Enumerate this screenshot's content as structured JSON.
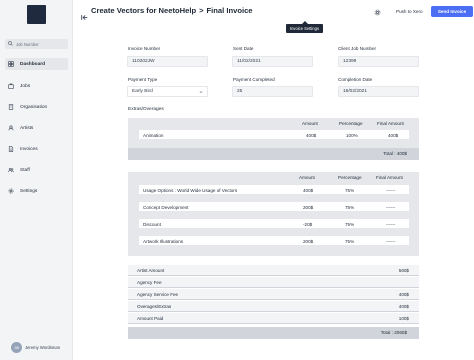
{
  "sidebar": {
    "search_placeholder": "Job Number",
    "items": [
      {
        "label": "Dashboard",
        "icon": "dashboard-icon",
        "active": true
      },
      {
        "label": "Jobs",
        "icon": "briefcase-icon",
        "active": false
      },
      {
        "label": "Organisation",
        "icon": "building-icon",
        "active": false
      },
      {
        "label": "Artists",
        "icon": "user-icon",
        "active": false
      },
      {
        "label": "Invoices",
        "icon": "document-icon",
        "active": false
      },
      {
        "label": "Staff",
        "icon": "users-icon",
        "active": false
      },
      {
        "label": "Settings",
        "icon": "gear-icon",
        "active": false
      }
    ],
    "user": {
      "initials": "JW",
      "name": "Jeremy Wordsman"
    }
  },
  "header": {
    "crumb_1": "Create Vectors for NeetoHelp",
    "crumb_sep": ">",
    "crumb_2": "Final Invoice",
    "tooltip": "Invoice Settings",
    "push_label": "Push to Xero",
    "send_label": "Send Invoice",
    "accent_color": "#4c6ef5"
  },
  "form": {
    "invoice_number_label": "Invoice Number",
    "invoice_number": "110202JW",
    "sent_date_label": "Sent Date",
    "sent_date": "11/02/2021",
    "client_job_label": "Client Job Number",
    "client_job": "12399",
    "payment_type_label": "Payment Type",
    "payment_type": "Early Bird",
    "payment_completed_label": "Payment Completed",
    "payment_completed": "25",
    "completion_date_label": "Completion Date",
    "completion_date": "16/02/2021"
  },
  "extras": {
    "title": "Extras/Overages",
    "headers": {
      "amount": "Amount",
      "percentage": "Percentage",
      "final": "Final Amount"
    },
    "rows": [
      {
        "name": "Animation",
        "amount": "400$",
        "percentage": "100%",
        "final": "400$"
      }
    ],
    "total": "Total : 400$"
  },
  "usage": {
    "headers": {
      "amount": "Amount",
      "percentage": "Percentage",
      "final": "Final Amount"
    },
    "rows": [
      {
        "name": "Usage Options : World Wide Usage of Vectors",
        "amount": "400$",
        "percentage": "75%",
        "final": "------"
      },
      {
        "name": "Concept Development",
        "amount": "200$",
        "percentage": "75%",
        "final": "------"
      },
      {
        "name": "Discount",
        "amount": "-20$",
        "percentage": "75%",
        "final": "------"
      },
      {
        "name": "Artwork Illustrations",
        "amount": "200$",
        "percentage": "75%",
        "final": "------"
      }
    ]
  },
  "summary": {
    "rows": [
      {
        "label": "Artist Amount",
        "value": "560$"
      },
      {
        "label": "Agency Fee",
        "value": ""
      },
      {
        "label": "Agency Service Fee",
        "value": "400$"
      },
      {
        "label": "Overages/Extras",
        "value": "400$"
      },
      {
        "label": "Amount Paid",
        "value": "100$"
      }
    ],
    "total": "Total : 2060$"
  }
}
